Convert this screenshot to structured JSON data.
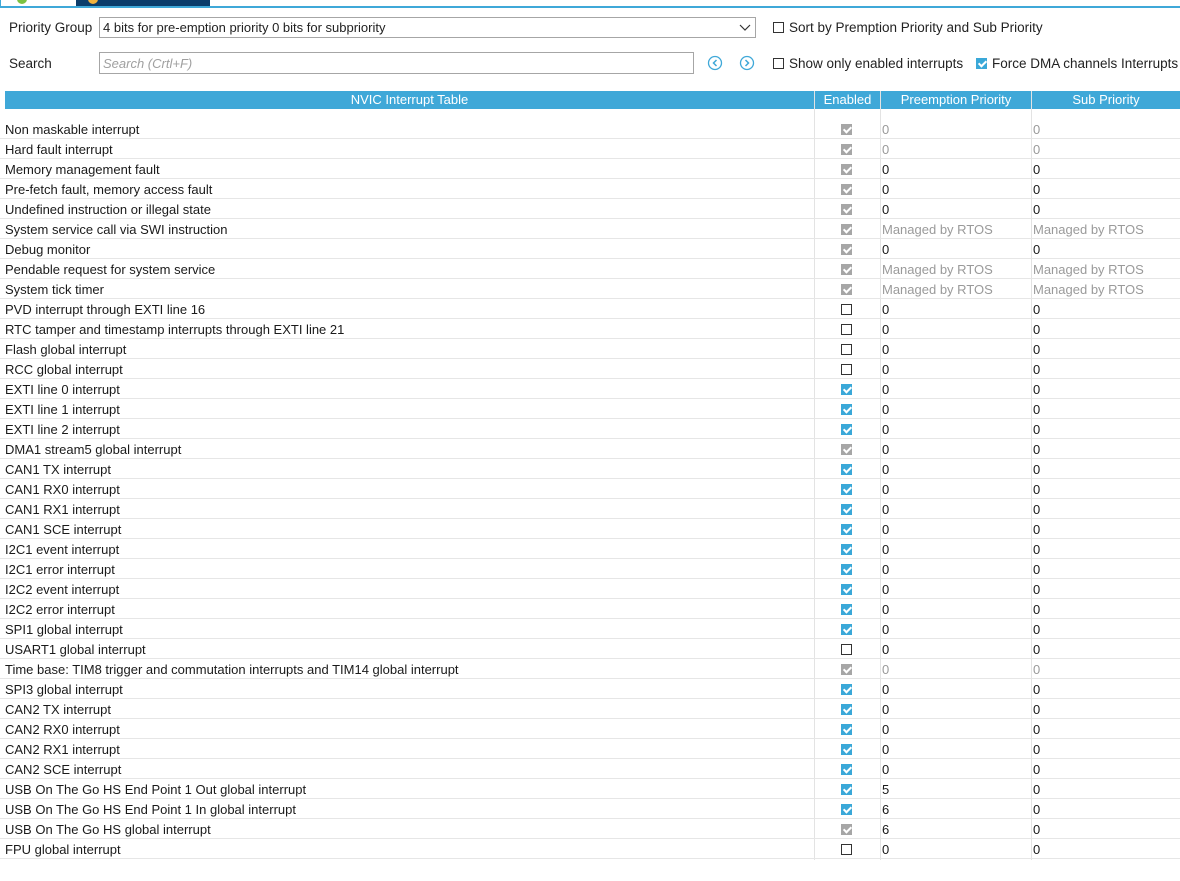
{
  "colors": {
    "accent": "#3fa8d8",
    "dark_tab": "#0b3d6b",
    "disabled": "#a6a6a6"
  },
  "toolbar": {
    "priority_group_label": "Priority Group",
    "priority_group_value": "4 bits for pre-emption priority 0 bits for subpriority",
    "search_label": "Search",
    "search_placeholder": "Search (Crtl+F)",
    "sort_label": "Sort by Premption Priority and Sub Priority",
    "sort_checked": false,
    "show_enabled_label": "Show only enabled interrupts",
    "show_enabled_checked": false,
    "force_dma_label": "Force DMA channels Interrupts",
    "force_dma_checked": true
  },
  "table": {
    "headers": [
      "NVIC Interrupt Table",
      "Enabled",
      "Preemption Priority",
      "Sub Priority"
    ],
    "rows": [
      {
        "name": "Non maskable interrupt",
        "enabled": "disabled",
        "pre": "0",
        "sub": "0",
        "grey": true
      },
      {
        "name": "Hard fault interrupt",
        "enabled": "disabled",
        "pre": "0",
        "sub": "0",
        "grey": true
      },
      {
        "name": "Memory management fault",
        "enabled": "disabled",
        "pre": "0",
        "sub": "0",
        "grey": false
      },
      {
        "name": "Pre-fetch fault, memory access fault",
        "enabled": "disabled",
        "pre": "0",
        "sub": "0",
        "grey": false
      },
      {
        "name": "Undefined instruction or illegal state",
        "enabled": "disabled",
        "pre": "0",
        "sub": "0",
        "grey": false
      },
      {
        "name": "System service call via SWI instruction",
        "enabled": "disabled",
        "pre": "Managed by RTOS",
        "sub": "Managed by RTOS",
        "grey": true
      },
      {
        "name": "Debug monitor",
        "enabled": "disabled",
        "pre": "0",
        "sub": "0",
        "grey": false
      },
      {
        "name": "Pendable request for system service",
        "enabled": "disabled",
        "pre": "Managed by RTOS",
        "sub": "Managed by RTOS",
        "grey": true
      },
      {
        "name": "System tick timer",
        "enabled": "disabled",
        "pre": "Managed by RTOS",
        "sub": "Managed by RTOS",
        "grey": true
      },
      {
        "name": "PVD interrupt through EXTI line 16",
        "enabled": "off",
        "pre": "0",
        "sub": "0",
        "grey": false
      },
      {
        "name": "RTC tamper and timestamp interrupts through EXTI line 21",
        "enabled": "off",
        "pre": "0",
        "sub": "0",
        "grey": false
      },
      {
        "name": "Flash global interrupt",
        "enabled": "off",
        "pre": "0",
        "sub": "0",
        "grey": false
      },
      {
        "name": "RCC global interrupt",
        "enabled": "off",
        "pre": "0",
        "sub": "0",
        "grey": false
      },
      {
        "name": "EXTI line 0 interrupt",
        "enabled": "on",
        "pre": "0",
        "sub": "0",
        "grey": false
      },
      {
        "name": "EXTI line 1 interrupt",
        "enabled": "on",
        "pre": "0",
        "sub": "0",
        "grey": false
      },
      {
        "name": "EXTI line 2 interrupt",
        "enabled": "on",
        "pre": "0",
        "sub": "0",
        "grey": false
      },
      {
        "name": "DMA1 stream5 global interrupt",
        "enabled": "disabled",
        "pre": "0",
        "sub": "0",
        "grey": false
      },
      {
        "name": "CAN1 TX interrupt",
        "enabled": "on",
        "pre": "0",
        "sub": "0",
        "grey": false
      },
      {
        "name": "CAN1 RX0 interrupt",
        "enabled": "on",
        "pre": "0",
        "sub": "0",
        "grey": false
      },
      {
        "name": "CAN1 RX1 interrupt",
        "enabled": "on",
        "pre": "0",
        "sub": "0",
        "grey": false
      },
      {
        "name": "CAN1 SCE interrupt",
        "enabled": "on",
        "pre": "0",
        "sub": "0",
        "grey": false
      },
      {
        "name": "I2C1 event interrupt",
        "enabled": "on",
        "pre": "0",
        "sub": "0",
        "grey": false
      },
      {
        "name": "I2C1 error interrupt",
        "enabled": "on",
        "pre": "0",
        "sub": "0",
        "grey": false
      },
      {
        "name": "I2C2 event interrupt",
        "enabled": "on",
        "pre": "0",
        "sub": "0",
        "grey": false
      },
      {
        "name": "I2C2 error interrupt",
        "enabled": "on",
        "pre": "0",
        "sub": "0",
        "grey": false
      },
      {
        "name": "SPI1 global interrupt",
        "enabled": "on",
        "pre": "0",
        "sub": "0",
        "grey": false
      },
      {
        "name": "USART1 global interrupt",
        "enabled": "off",
        "pre": "0",
        "sub": "0",
        "grey": false
      },
      {
        "name": "Time base: TIM8 trigger and commutation interrupts and TIM14 global interrupt",
        "enabled": "disabled",
        "pre": "0",
        "sub": "0",
        "grey": true
      },
      {
        "name": "SPI3 global interrupt",
        "enabled": "on",
        "pre": "0",
        "sub": "0",
        "grey": false
      },
      {
        "name": "CAN2 TX interrupt",
        "enabled": "on",
        "pre": "0",
        "sub": "0",
        "grey": false
      },
      {
        "name": "CAN2 RX0 interrupt",
        "enabled": "on",
        "pre": "0",
        "sub": "0",
        "grey": false
      },
      {
        "name": "CAN2 RX1 interrupt",
        "enabled": "on",
        "pre": "0",
        "sub": "0",
        "grey": false
      },
      {
        "name": "CAN2 SCE interrupt",
        "enabled": "on",
        "pre": "0",
        "sub": "0",
        "grey": false
      },
      {
        "name": "USB On The Go HS End Point 1 Out global interrupt",
        "enabled": "on",
        "pre": "5",
        "sub": "0",
        "grey": false
      },
      {
        "name": "USB On The Go HS End Point 1 In global interrupt",
        "enabled": "on",
        "pre": "6",
        "sub": "0",
        "grey": false
      },
      {
        "name": "USB On The Go HS global interrupt",
        "enabled": "disabled",
        "pre": "6",
        "sub": "0",
        "grey": false
      },
      {
        "name": "FPU global interrupt",
        "enabled": "off",
        "pre": "0",
        "sub": "0",
        "grey": false
      }
    ]
  }
}
